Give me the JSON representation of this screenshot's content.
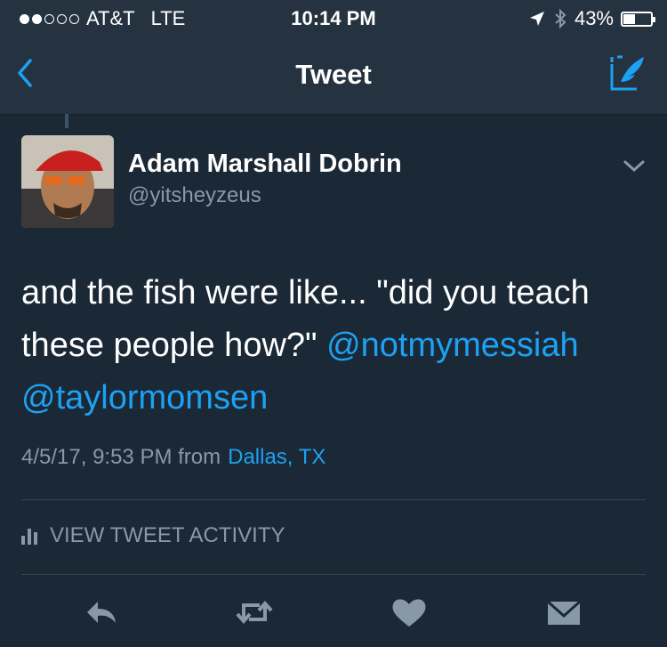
{
  "status_bar": {
    "signal_filled": 2,
    "signal_total": 5,
    "carrier": "AT&T",
    "network": "LTE",
    "time": "10:14 PM",
    "battery_percent_label": "43%",
    "battery_level": 0.43
  },
  "nav": {
    "title": "Tweet"
  },
  "tweet": {
    "author_name": "Adam Marshall Dobrin",
    "author_handle": "@yitsheyzeus",
    "text_part1": "and the fish were like... \"did you teach these people how?\" ",
    "mention1": "@notmymessiah",
    "mention2": "@taylormomsen",
    "timestamp": "4/5/17, 9:53 PM from",
    "location": "Dallas, TX"
  },
  "activity": {
    "label": "VIEW TWEET ACTIVITY"
  },
  "colors": {
    "background": "#1b2836",
    "bar": "#253341",
    "accent": "#1da1f2",
    "muted": "#8899a6"
  },
  "icons": [
    "back-chevron-icon",
    "compose-tweet-icon",
    "location-arrow-icon",
    "bluetooth-icon",
    "battery-icon",
    "chevron-down-icon",
    "bar-chart-icon",
    "reply-icon",
    "retweet-icon",
    "like-heart-icon",
    "direct-message-icon"
  ]
}
